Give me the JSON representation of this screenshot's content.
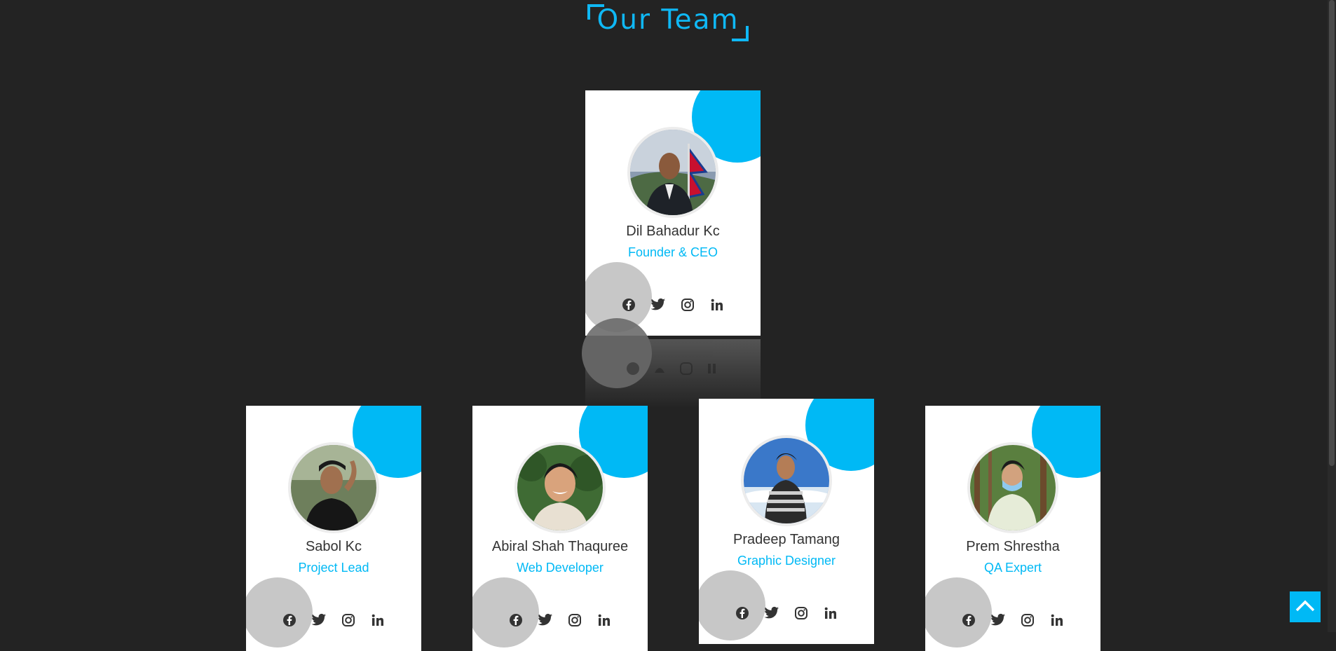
{
  "section": {
    "title": "Our Team"
  },
  "team": [
    {
      "name": "Dil Bahadur Kc",
      "role": "Founder & CEO"
    },
    {
      "name": "Sabol Kc",
      "role": "Project Lead"
    },
    {
      "name": "Abiral Shah Thaquree",
      "role": "Web Developer"
    },
    {
      "name": "Pradeep Tamang",
      "role": "Graphic Designer"
    },
    {
      "name": "Prem Shrestha",
      "role": "QA Expert"
    }
  ],
  "socials": [
    "facebook-icon",
    "twitter-icon",
    "instagram-icon",
    "linkedin-icon"
  ],
  "colors": {
    "background": "#232323",
    "accent": "#00b9f5",
    "card": "#ffffff",
    "accent_gray": "#c7c7c7"
  }
}
